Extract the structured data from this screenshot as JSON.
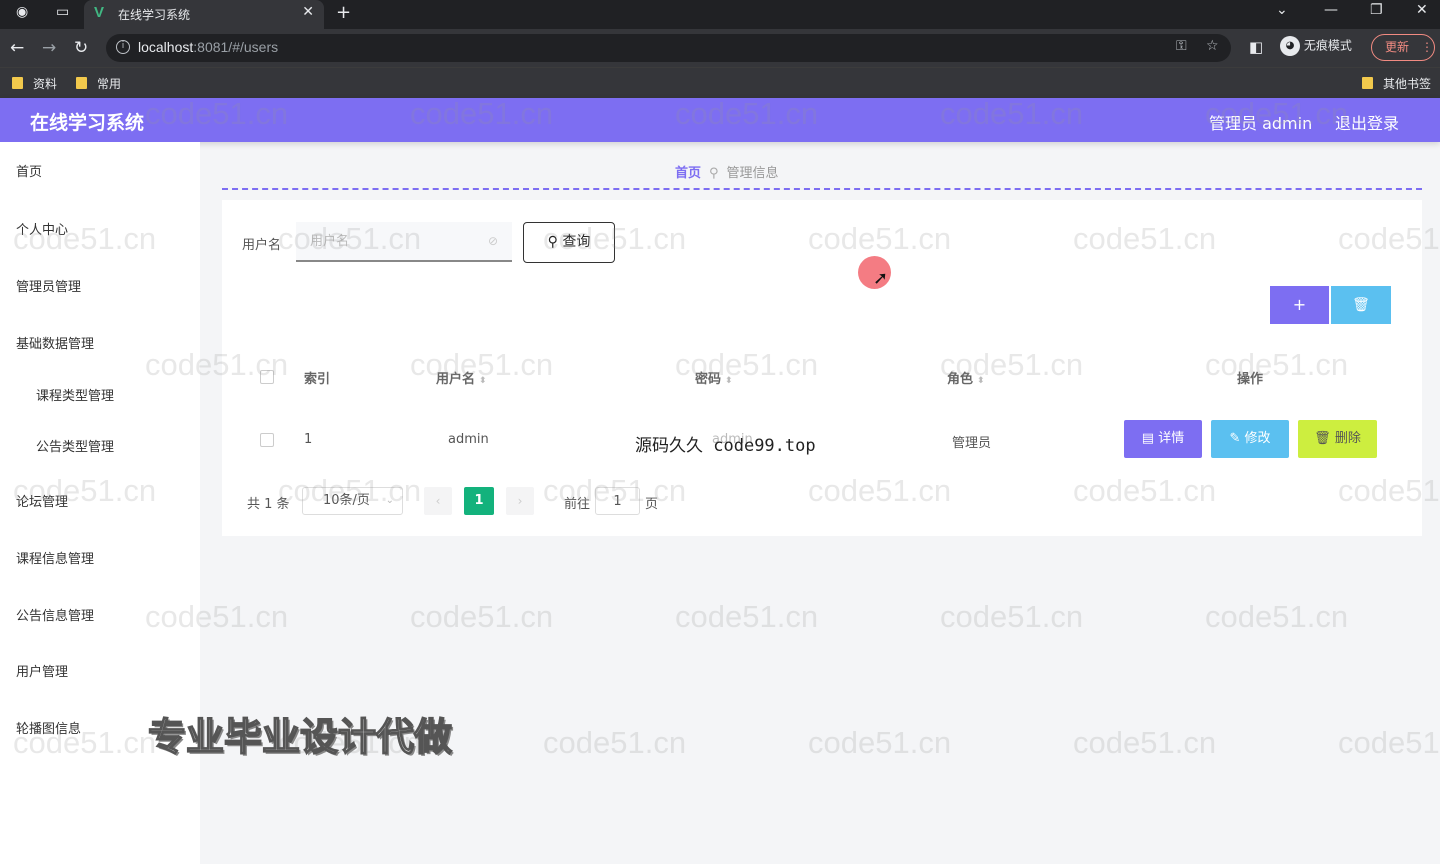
{
  "browser": {
    "tab_title": "在线学习系统",
    "tab_logo": "V",
    "url_host": "localhost",
    "url_rest": ":8081/#/users",
    "incognito_label": "无痕模式",
    "update_label": "更新",
    "bookmarks": [
      "资料",
      "常用"
    ],
    "other_bookmarks": "其他书签"
  },
  "header": {
    "title": "在线学习系统",
    "user": "管理员 admin",
    "logout": "退出登录"
  },
  "sidebar": {
    "items": [
      "首页",
      "个人中心",
      "管理员管理",
      "基础数据管理",
      "课程类型管理",
      "公告类型管理",
      "论坛管理",
      "课程信息管理",
      "公告信息管理",
      "用户管理",
      "轮播图信息"
    ]
  },
  "breadcrumb": {
    "home": "首页",
    "current": "管理信息"
  },
  "search": {
    "label": "用户名",
    "placeholder": "用户名",
    "button": "查询"
  },
  "toolbar": {
    "add": "+",
    "delete": "🗑"
  },
  "table": {
    "headers": [
      "索引",
      "用户名",
      "密码",
      "角色",
      "操作"
    ],
    "rows": [
      {
        "index": "1",
        "username": "admin",
        "password": "admin",
        "role": "管理员"
      }
    ],
    "actions": {
      "detail": "详情",
      "edit": "修改",
      "delete": "删除"
    }
  },
  "pagination": {
    "total": "共 1 条",
    "page_size": "10条/页",
    "current": "1",
    "goto": "前往",
    "goto_value": "1",
    "page_unit": "页"
  },
  "overlays": {
    "watermark": "code51.cn",
    "source_text": "源码久久",
    "source_url": "code99.top",
    "ad_text": "专业毕业设计代做"
  }
}
